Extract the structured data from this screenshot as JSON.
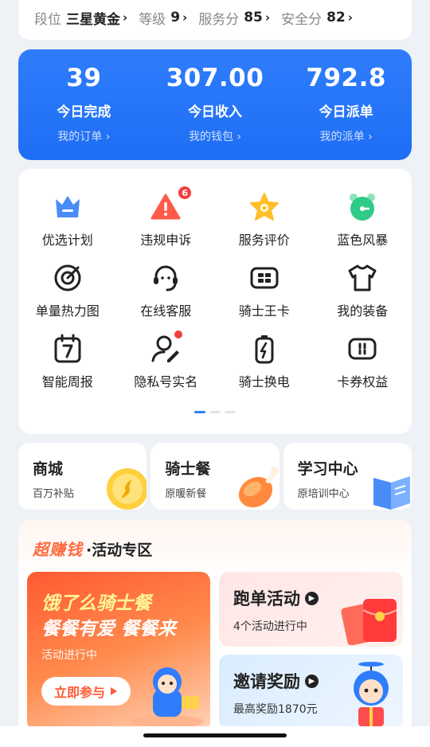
{
  "rank_bar": [
    {
      "label": "段位",
      "value": "三星黄金"
    },
    {
      "label": "等级",
      "value": "9"
    },
    {
      "label": "服务分",
      "value": "85"
    },
    {
      "label": "安全分",
      "value": "82"
    }
  ],
  "stats": [
    {
      "value": "39",
      "label": "今日完成",
      "link": "我的订单 ›"
    },
    {
      "value": "307.00",
      "label": "今日收入",
      "link": "我的钱包 ›"
    },
    {
      "value": "792.8",
      "label": "今日派单",
      "link": "我的派单 ›"
    }
  ],
  "grid": [
    {
      "label": "优选计划",
      "icon": "crown-icon"
    },
    {
      "label": "违规申诉",
      "icon": "warning-icon",
      "badge": "6"
    },
    {
      "label": "服务评价",
      "icon": "star-icon"
    },
    {
      "label": "蓝色风暴",
      "icon": "alarm-clock-icon"
    },
    {
      "label": "单量热力图",
      "icon": "target-icon"
    },
    {
      "label": "在线客服",
      "icon": "headset-icon"
    },
    {
      "label": "骑士王卡",
      "icon": "card-icon"
    },
    {
      "label": "我的装备",
      "icon": "tshirt-icon"
    },
    {
      "label": "智能周报",
      "icon": "calendar-icon"
    },
    {
      "label": "隐私号实名",
      "icon": "user-edit-icon",
      "dot": true
    },
    {
      "label": "骑士换电",
      "icon": "battery-icon"
    },
    {
      "label": "卡券权益",
      "icon": "coupon-icon"
    }
  ],
  "shortcuts": [
    {
      "title": "商城",
      "sub": "百万补贴"
    },
    {
      "title": "骑士餐",
      "sub": "原暖新餐"
    },
    {
      "title": "学习中心",
      "sub": "原培训中心"
    }
  ],
  "zone": {
    "brand": "超赚钱",
    "title": "·活动专区",
    "promo": {
      "line1": "饿了么骑士餐",
      "line2": "餐餐有爱 餐餐来",
      "status": "活动进行中",
      "button": "立即参与"
    },
    "activities": [
      {
        "title": "跑单活动",
        "sub": "4个活动进行中"
      },
      {
        "title": "邀请奖励",
        "sub": "最高奖励1870元"
      }
    ]
  },
  "colors": {
    "primary": "#2f7dfc",
    "accent": "#ff6a3d",
    "badge": "#f43f3f"
  }
}
